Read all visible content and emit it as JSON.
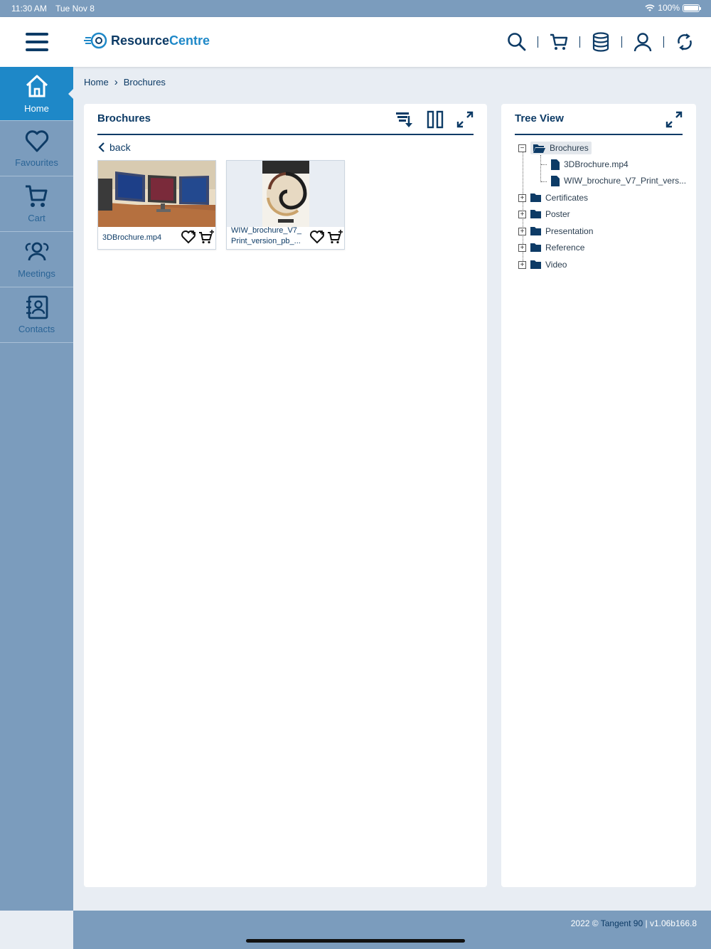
{
  "status": {
    "time": "11:30 AM",
    "date": "Tue Nov 8",
    "battery": "100%"
  },
  "header": {
    "logo_part1": "Resource",
    "logo_part2": "Centre",
    "icons": [
      "search-icon",
      "cart-icon",
      "database-icon",
      "user-icon",
      "sync-icon"
    ]
  },
  "sidebar": {
    "items": [
      {
        "label": "Home",
        "icon": "home-icon",
        "active": true
      },
      {
        "label": "Favourites",
        "icon": "heart-icon"
      },
      {
        "label": "Cart",
        "icon": "cart-icon"
      },
      {
        "label": "Meetings",
        "icon": "meetings-icon"
      },
      {
        "label": "Contacts",
        "icon": "contacts-icon"
      }
    ]
  },
  "breadcrumb": {
    "home": "Home",
    "sep": "›",
    "current": "Brochures"
  },
  "main": {
    "title": "Brochures",
    "back": "back",
    "files": [
      {
        "name": "3DBrochure.mp4"
      },
      {
        "name": "WIW_brochure_V7_ Print_version_pb_..."
      }
    ]
  },
  "tree": {
    "title": "Tree View",
    "root": "Brochures",
    "children": [
      "3DBrochure.mp4",
      "WIW_brochure_V7_Print_vers..."
    ],
    "folders": [
      "Certificates",
      "Poster",
      "Presentation",
      "Reference",
      "Video"
    ]
  },
  "footer": {
    "year": "2022 ©",
    "brand": "Tangent 90",
    "sep": "|",
    "version": "v1.06b166.8"
  },
  "colors": {
    "navy": "#0d3b66",
    "accent": "#1e88c8",
    "sidebar": "#7b9cbd"
  }
}
